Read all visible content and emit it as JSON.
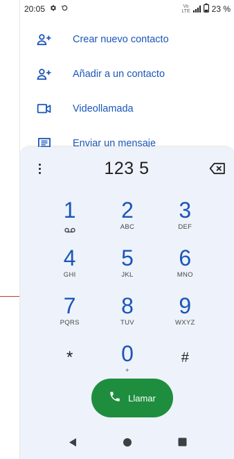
{
  "status_bar": {
    "time": "20:05",
    "volte_top": "Vo",
    "volte_bottom": "LTE",
    "battery": "23 %"
  },
  "actions": [
    {
      "icon": "person-add-icon",
      "label": "Crear nuevo contacto"
    },
    {
      "icon": "person-add-icon",
      "label": "Añadir a un contacto"
    },
    {
      "icon": "videocam-icon",
      "label": "Videollamada"
    },
    {
      "icon": "message-icon",
      "label": "Enviar un mensaje"
    }
  ],
  "dialer": {
    "number": "123 5",
    "keys": [
      {
        "digit": "1",
        "letters": ""
      },
      {
        "digit": "2",
        "letters": "ABC"
      },
      {
        "digit": "3",
        "letters": "DEF"
      },
      {
        "digit": "4",
        "letters": "GHI"
      },
      {
        "digit": "5",
        "letters": "JKL"
      },
      {
        "digit": "6",
        "letters": "MNO"
      },
      {
        "digit": "7",
        "letters": "PQRS"
      },
      {
        "digit": "8",
        "letters": "TUV"
      },
      {
        "digit": "9",
        "letters": "WXYZ"
      },
      {
        "digit": "*",
        "letters": ""
      },
      {
        "digit": "0",
        "letters": "+"
      },
      {
        "digit": "#",
        "letters": ""
      }
    ],
    "call_label": "Llamar"
  },
  "colors": {
    "accent": "#1a56b8",
    "call_green": "#1e8e3e",
    "dialer_bg": "#eef2fa",
    "pointer": "#c0392b"
  }
}
